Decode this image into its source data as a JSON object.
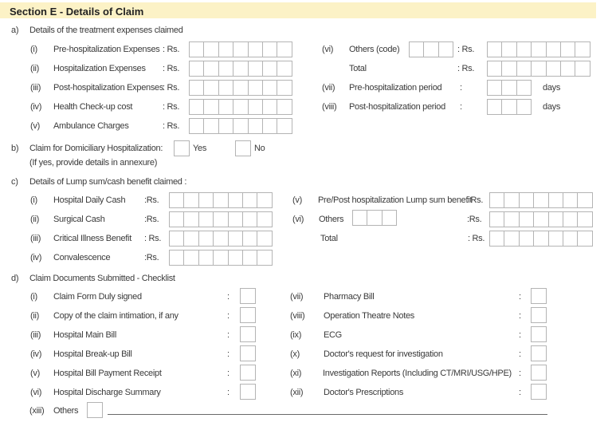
{
  "header": {
    "title": "Section E - Details of Claim",
    "color": "#fcf2c6"
  },
  "sectionA": {
    "marker": "a)",
    "title": "Details of the treatment expenses claimed",
    "left": [
      {
        "num": "(i)",
        "label": "Pre-hospitalization Expenses",
        "sep": ": Rs."
      },
      {
        "num": "(ii)",
        "label": "Hospitalization Expenses",
        "sep": ": Rs."
      },
      {
        "num": "(iii)",
        "label": "Post-hospitalization Expenses",
        "sep": ": Rs."
      },
      {
        "num": "(iv)",
        "label": "Health Check-up cost",
        "sep": ": Rs."
      },
      {
        "num": "(v)",
        "label": "Ambulance Charges",
        "sep": ": Rs."
      }
    ],
    "right": [
      {
        "num": "(vi)",
        "label": "Others (code)",
        "sep": ": Rs."
      },
      {
        "num": "",
        "label": "Total",
        "sep": ": Rs."
      },
      {
        "num": "(vii)",
        "label": "Pre-hospitalization period",
        "sep": ":",
        "unit": "days"
      },
      {
        "num": "(viii)",
        "label": "Post-hospitalization period",
        "sep": ":",
        "unit": "days"
      }
    ]
  },
  "sectionB": {
    "marker": "b)",
    "title": "Claim for Domiciliary Hospitalization:",
    "note": "(If yes, provide details in annexure)",
    "yes": "Yes",
    "no": "No"
  },
  "sectionC": {
    "marker": "c)",
    "title": "Details of Lump sum/cash benefit claimed :",
    "left": [
      {
        "num": "(i)",
        "label": "Hospital Daily Cash",
        "sep": ":Rs."
      },
      {
        "num": "(ii)",
        "label": "Surgical Cash",
        "sep": ":Rs."
      },
      {
        "num": "(iii)",
        "label": "Critical Illness Benefit",
        "sep": ": Rs."
      },
      {
        "num": "(iv)",
        "label": "Convalescence",
        "sep": ":Rs."
      }
    ],
    "right": [
      {
        "num": "(v)",
        "label": "Pre/Post hospitalization Lump sum benefit",
        "sep": ": Rs."
      },
      {
        "num": "(vi)",
        "label": "Others",
        "sep": ":Rs."
      },
      {
        "num": "",
        "label": "Total",
        "sep": ": Rs."
      }
    ]
  },
  "sectionD": {
    "marker": "d)",
    "title": "Claim Documents Submitted - Checklist",
    "sep": ":",
    "left": [
      {
        "num": "(i)",
        "label": "Claim Form Duly signed"
      },
      {
        "num": "(ii)",
        "label": "Copy of the claim intimation, if any"
      },
      {
        "num": "(iii)",
        "label": "Hospital Main Bill"
      },
      {
        "num": "(iv)",
        "label": "Hospital Break-up Bill"
      },
      {
        "num": "(v)",
        "label": "Hospital Bill Payment Receipt"
      },
      {
        "num": "(vi)",
        "label": "Hospital Discharge Summary"
      }
    ],
    "right": [
      {
        "num": "(vii)",
        "label": "Pharmacy Bill"
      },
      {
        "num": "(viii)",
        "label": "Operation Theatre Notes"
      },
      {
        "num": "(ix)",
        "label": "ECG"
      },
      {
        "num": "(x)",
        "label": "Doctor's request for investigation"
      },
      {
        "num": "(xi)",
        "label": "Investigation Reports (Including CT/MRI/USG/HPE)"
      },
      {
        "num": "(xii)",
        "label": "Doctor's Prescriptions"
      }
    ],
    "others": {
      "num": "(xiii)",
      "label": "Others"
    }
  }
}
